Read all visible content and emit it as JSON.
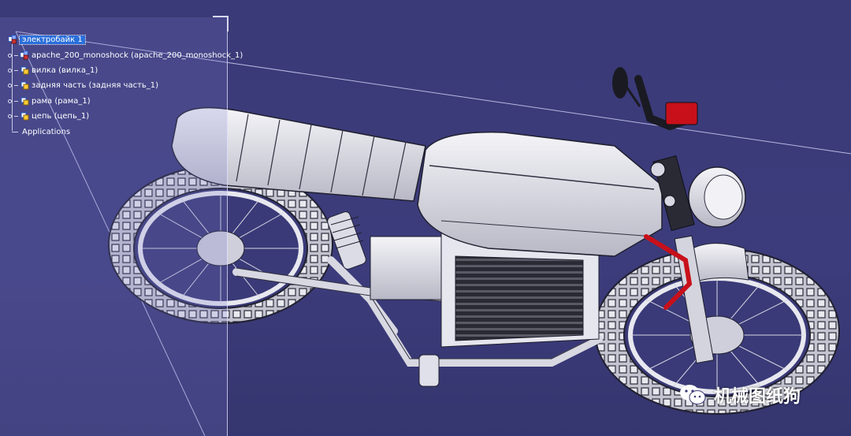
{
  "tree": {
    "root_label": "электробайк 1",
    "items": [
      {
        "label": "apache_200_monoshock (apache_200_monoshock_1)"
      },
      {
        "label": "вилка (вилка_1)"
      },
      {
        "label": "задняя часть (задняя часть_1)"
      },
      {
        "label": "рама (рама_1)"
      },
      {
        "label": "цепь (цепь_1)"
      }
    ],
    "applications_label": "Applications"
  },
  "watermark": {
    "text": "机械图纸狗"
  },
  "colors": {
    "background": "#3a3a78",
    "model": "#e6e6ee",
    "accent_red": "#c8101a",
    "selection": "#2a6fdb"
  }
}
